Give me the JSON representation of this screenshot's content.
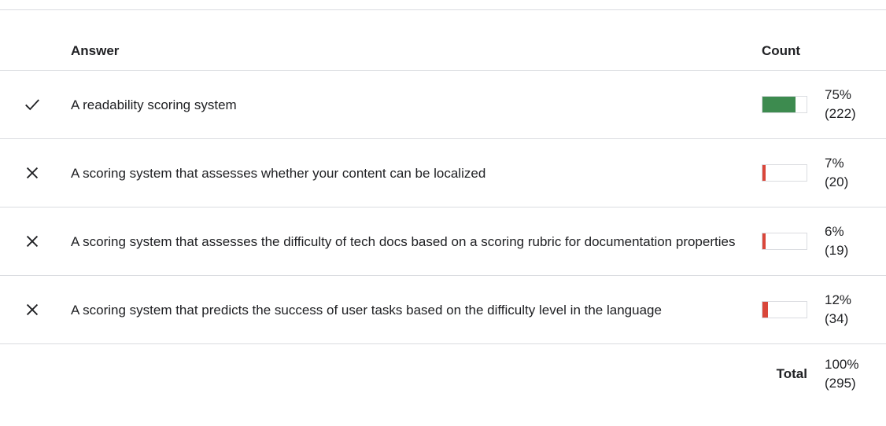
{
  "header": {
    "answer": "Answer",
    "count": "Count"
  },
  "colors": {
    "correct": "#3d8b4f",
    "incorrect": "#d9463a",
    "border": "#dadce0",
    "text": "#202124"
  },
  "rows": [
    {
      "status": "correct",
      "icon": "check-icon",
      "answer": "A readability scoring system",
      "fraction": 0.75,
      "percent": "75%",
      "count": "(222)"
    },
    {
      "status": "incorrect",
      "icon": "close-icon",
      "answer": "A scoring system that assesses whether your content can be localized",
      "fraction": 0.07,
      "percent": "7%",
      "count": "(20)"
    },
    {
      "status": "incorrect",
      "icon": "close-icon",
      "answer": "A scoring system that assesses the difficulty of tech docs based on a scoring rubric for documentation properties",
      "fraction": 0.06,
      "percent": "6%",
      "count": "(19)"
    },
    {
      "status": "incorrect",
      "icon": "close-icon",
      "answer": "A scoring system that predicts the success of user tasks based on the difficulty level in the language",
      "fraction": 0.12,
      "percent": "12%",
      "count": "(34)"
    }
  ],
  "total": {
    "label": "Total",
    "percent": "100%",
    "count": "(295)"
  }
}
